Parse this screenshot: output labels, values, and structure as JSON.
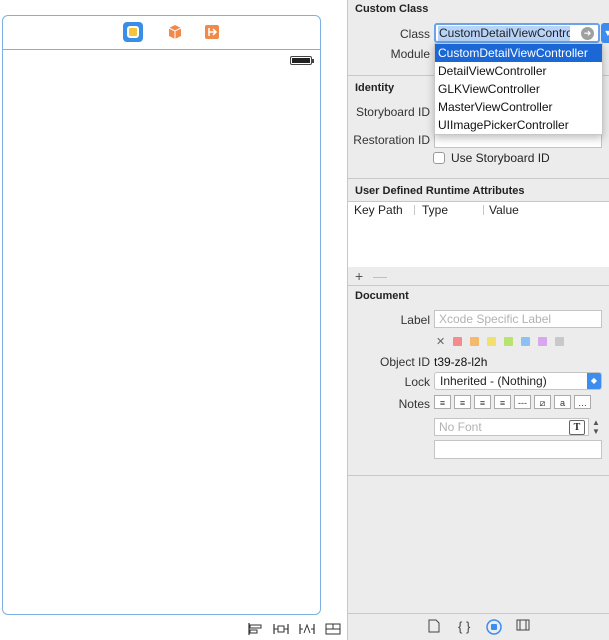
{
  "canvas": {
    "dock_icons": [
      "view-controller-icon",
      "first-responder-icon",
      "exit-icon"
    ],
    "bottom_tools": [
      "align-icon",
      "pin-icon",
      "resolve-icon",
      "resizing-icon"
    ]
  },
  "custom_class": {
    "section_title": "Custom Class",
    "class_label": "Class",
    "class_value": "CustomDetailViewContro",
    "module_label": "Module",
    "dropdown_items": [
      "CustomDetailViewController",
      "DetailViewController",
      "GLKViewController",
      "MasterViewController",
      "UIImagePickerController"
    ]
  },
  "identity": {
    "section_title": "Identity",
    "storyboard_id_label": "Storyboard ID",
    "restoration_id_label": "Restoration ID",
    "use_storyboard_id_label": "Use Storyboard ID"
  },
  "runtime_attributes": {
    "section_title": "User Defined Runtime Attributes",
    "columns": [
      "Key Path",
      "Type",
      "Value"
    ],
    "add_symbol": "+",
    "remove_symbol": "—"
  },
  "document": {
    "section_title": "Document",
    "label_label": "Label",
    "label_placeholder": "Xcode Specific Label",
    "clear_symbol": "✕",
    "swatch_colors": [
      "#f48c8c",
      "#f5b96b",
      "#f2e06d",
      "#b7e36f",
      "#8cc2f3",
      "#d9a7ee",
      "#c8c8c8"
    ],
    "object_id_label": "Object ID",
    "object_id_value": "t39-z8-l2h",
    "lock_label": "Lock",
    "lock_value": "Inherited - (Nothing)",
    "notes_label": "Notes",
    "font_placeholder": "No Font",
    "font_button": "T"
  },
  "inspector_tabs": [
    "file-inspector-icon",
    "quick-help-icon",
    "identity-inspector-icon",
    "attributes-inspector-icon"
  ],
  "colors": {
    "accent": "#3d8df0",
    "selection": "#1c67d6",
    "scene_border": "#7fb0e3"
  }
}
